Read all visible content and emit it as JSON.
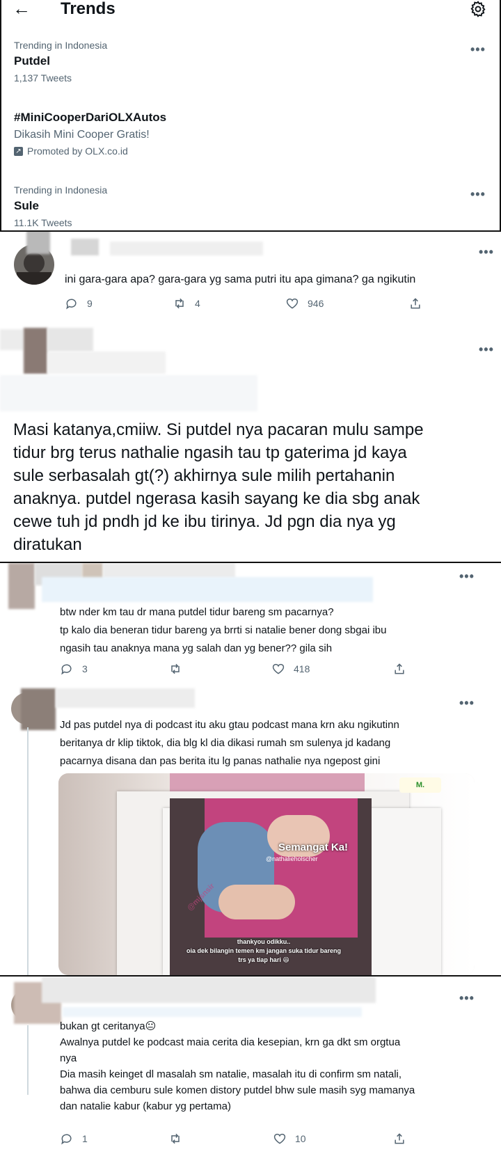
{
  "trends_header": {
    "back_icon": "←",
    "title": "Trends",
    "settings_icon": "gear-icon"
  },
  "trends": [
    {
      "context": "Trending in Indonesia",
      "name": "Putdel",
      "count": "1,137 Tweets"
    },
    {
      "name": "#MiniCooperDariOLXAutos",
      "description": "Dikasih Mini Cooper Gratis!",
      "promoted": "Promoted by OLX.co.id"
    },
    {
      "context": "Trending in Indonesia",
      "name": "Sule",
      "count": "11.1K Tweets"
    }
  ],
  "more_glyph": "•••",
  "tweet1": {
    "text": "ini gara-gara apa? gara-gara yg sama putri itu apa gimana? ga ngikutin",
    "replies": "9",
    "retweets": "4",
    "likes": "946"
  },
  "tweet2": {
    "text": "Masi katanya,cmiiw. Si putdel nya pacaran mulu sampe tidur brg terus nathalie ngasih tau tp gaterima jd kaya sule serbasalah gt(?) akhirnya sule milih pertahanin anaknya. putdel ngerasa kasih sayang ke dia sbg anak cewe tuh jd pndh jd ke ibu tirinya. Jd pgn dia nya yg diratukan",
    "lines": [
      "Masi katanya,cmiiw. Si putdel nya pacaran mulu sampe",
      "tidur brg terus nathalie ngasih tau tp gaterima jd kaya",
      "sule serbasalah gt(?) akhirnya sule milih pertahanin",
      "anaknya. putdel ngerasa kasih sayang ke dia sbg anak",
      "cewe tuh jd pndh jd ke ibu tirinya. Jd pgn dia nya yg",
      "diratukan"
    ]
  },
  "tweet3": {
    "lines": [
      "btw nder km tau dr mana putdel tidur bareng sm pacarnya?",
      "tp kalo dia beneran tidur bareng ya brrti si natalie bener dong sbgai ibu",
      "ngasih tau anaknya mana yg salah dan yg bener?? gila sih"
    ],
    "replies": "3",
    "likes": "418"
  },
  "tweet4": {
    "lines": [
      "Jd pas putdel nya di podcast itu aku gtau podcast mana krn aku ngikutinn",
      "beritanya dr klip tiktok, dia blg kl dia dikasi rumah sm sulenya jd kadang",
      "pacarnya disana dan pas berita itu lg panas nathalie nya ngepost gini"
    ],
    "media": {
      "story_title": "Semangat Ka!",
      "story_handle": "@nathalieholscher",
      "caption_lines": [
        "thankyou odikku..",
        "oia dek bilangin temen km jangan suka tidur bareng",
        "trs ya tiap hari 😆"
      ],
      "watermark": "@mjsnsir"
    }
  },
  "tweet5": {
    "lines": [
      "bukan gt ceritanya😐",
      "Awalnya putdel ke podcast maia cerita dia kesepian, krn ga dkt sm orgtua",
      "nya",
      "Dia masih keinget dl masalah sm natalie, masalah itu di confirm sm natali,",
      "bahwa dia cemburu sule komen distory putdel bhw sule masih syg mamanya",
      "dan natalie kabur (kabur yg pertama)"
    ],
    "replies": "1",
    "likes": "10"
  }
}
